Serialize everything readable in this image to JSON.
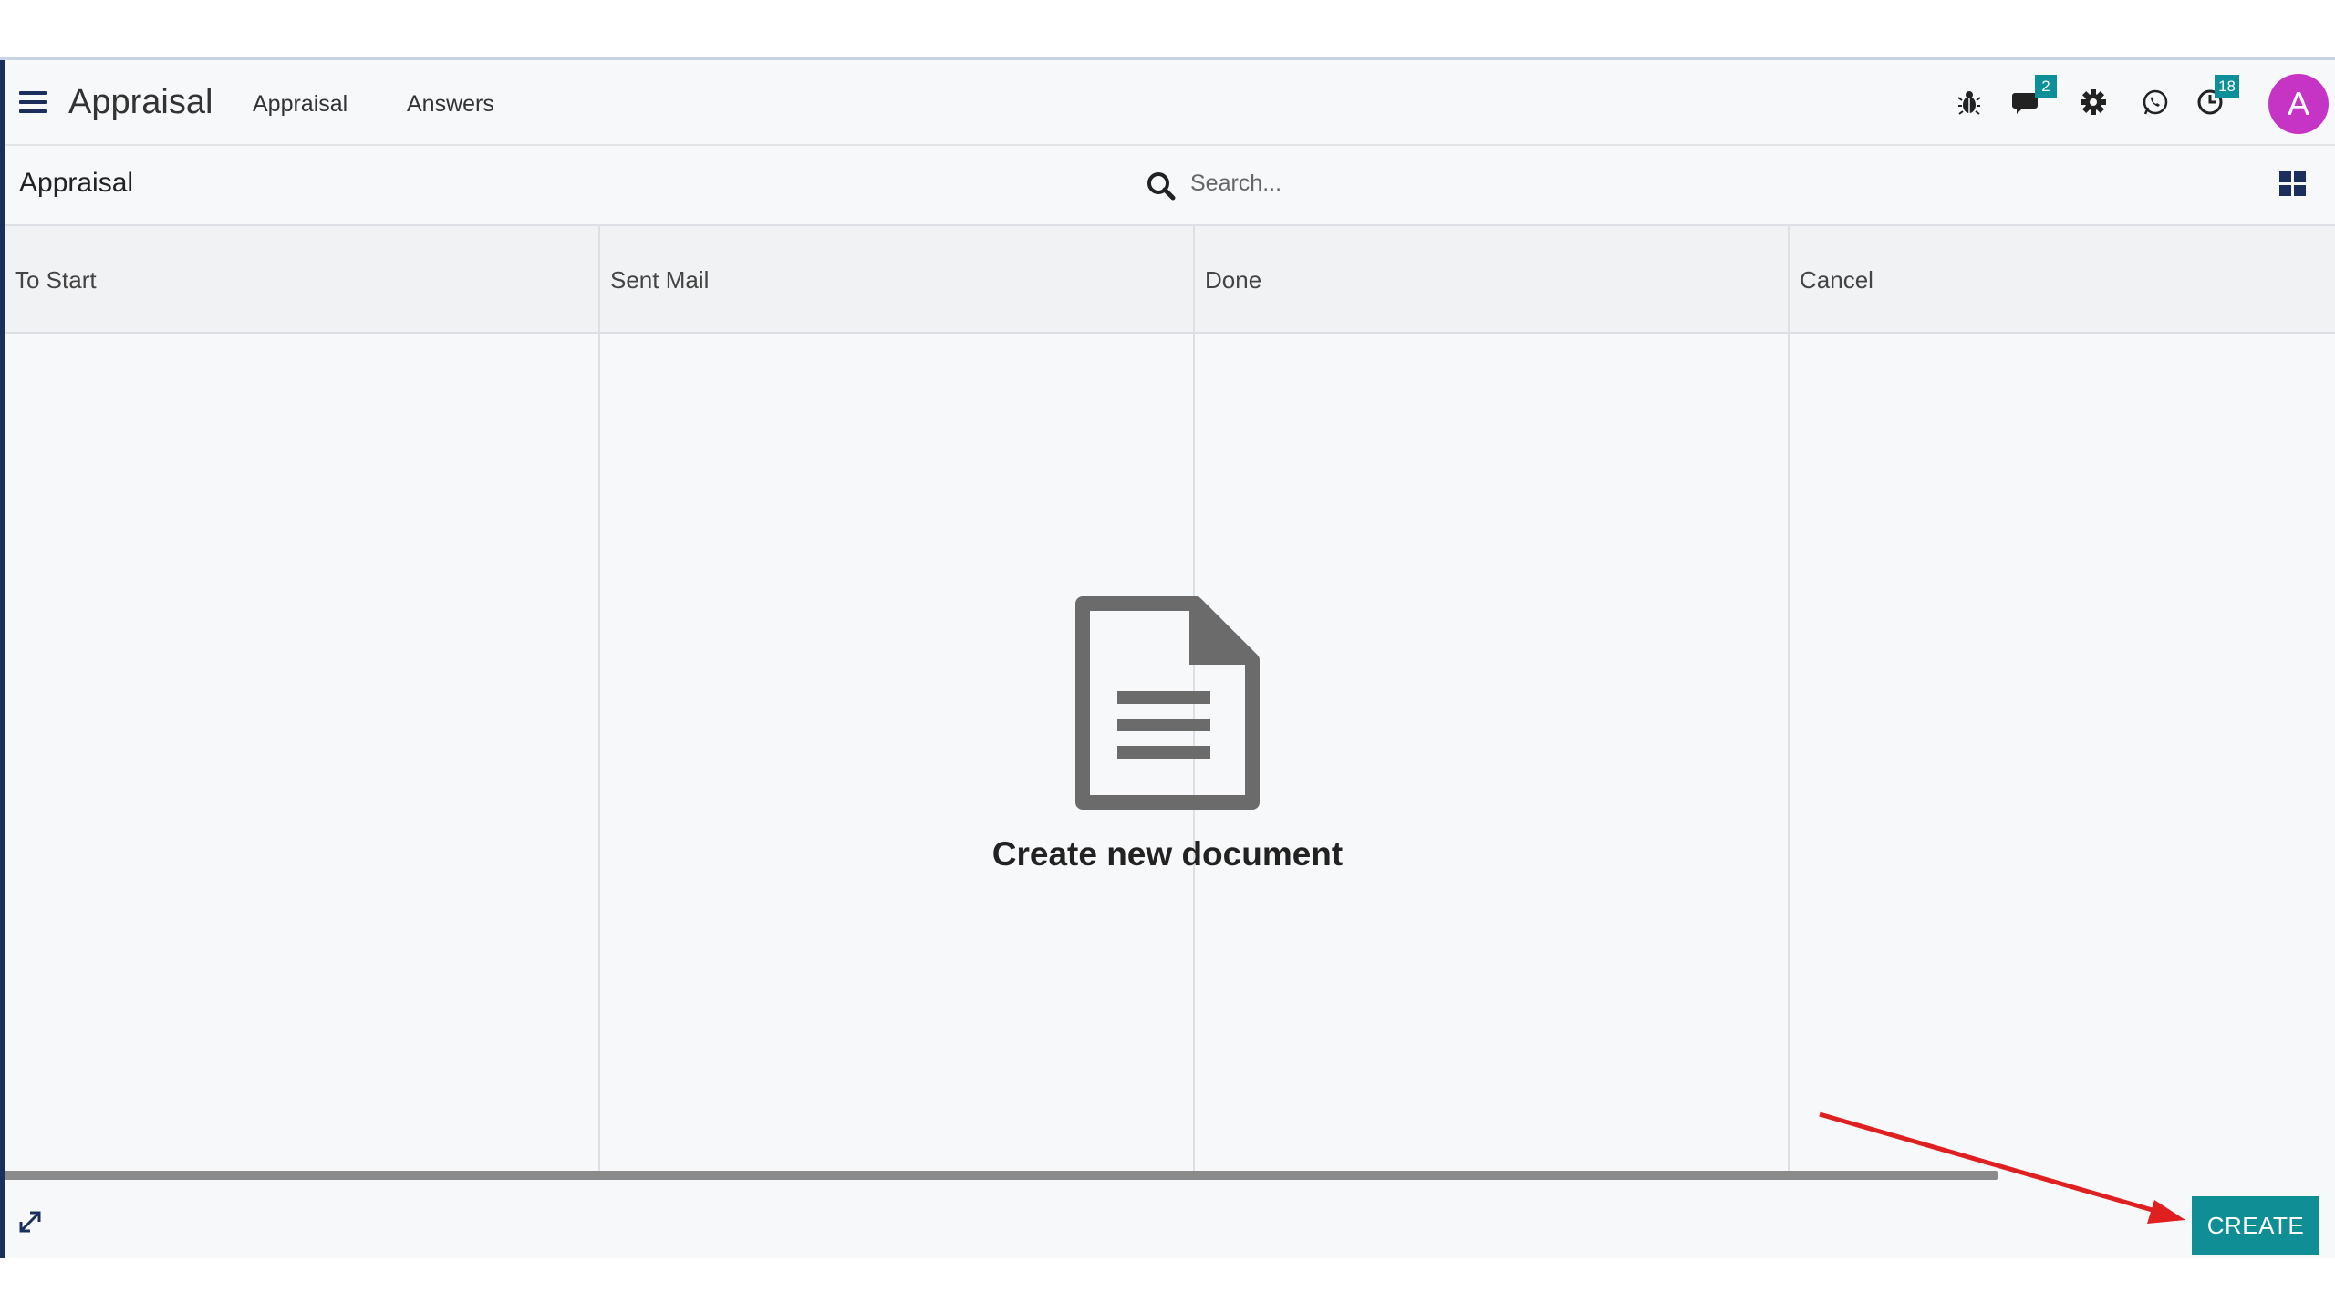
{
  "navbar": {
    "app_title": "Appraisal",
    "menu": [
      {
        "label": "Appraisal"
      },
      {
        "label": "Answers"
      }
    ],
    "icons": {
      "bug": "bug-icon",
      "messages_badge": "2",
      "settings": "gear-icon",
      "whatsapp": "whatsapp-icon",
      "activity_badge": "18"
    },
    "avatar_initial": "A",
    "avatar_color": "#c634c6"
  },
  "control_panel": {
    "breadcrumb": "Appraisal",
    "search_placeholder": "Search...",
    "view_toggle": "kanban-grid-icon"
  },
  "kanban": {
    "columns": [
      {
        "title": "To Start"
      },
      {
        "title": "Sent Mail"
      },
      {
        "title": "Done"
      },
      {
        "title": "Cancel"
      }
    ]
  },
  "empty_state": {
    "message": "Create new document"
  },
  "footer": {
    "create_label": "CREATE"
  },
  "colors": {
    "accent": "#0f8f95",
    "brand": "#1c2f5c",
    "annotation_arrow": "#e02020"
  }
}
